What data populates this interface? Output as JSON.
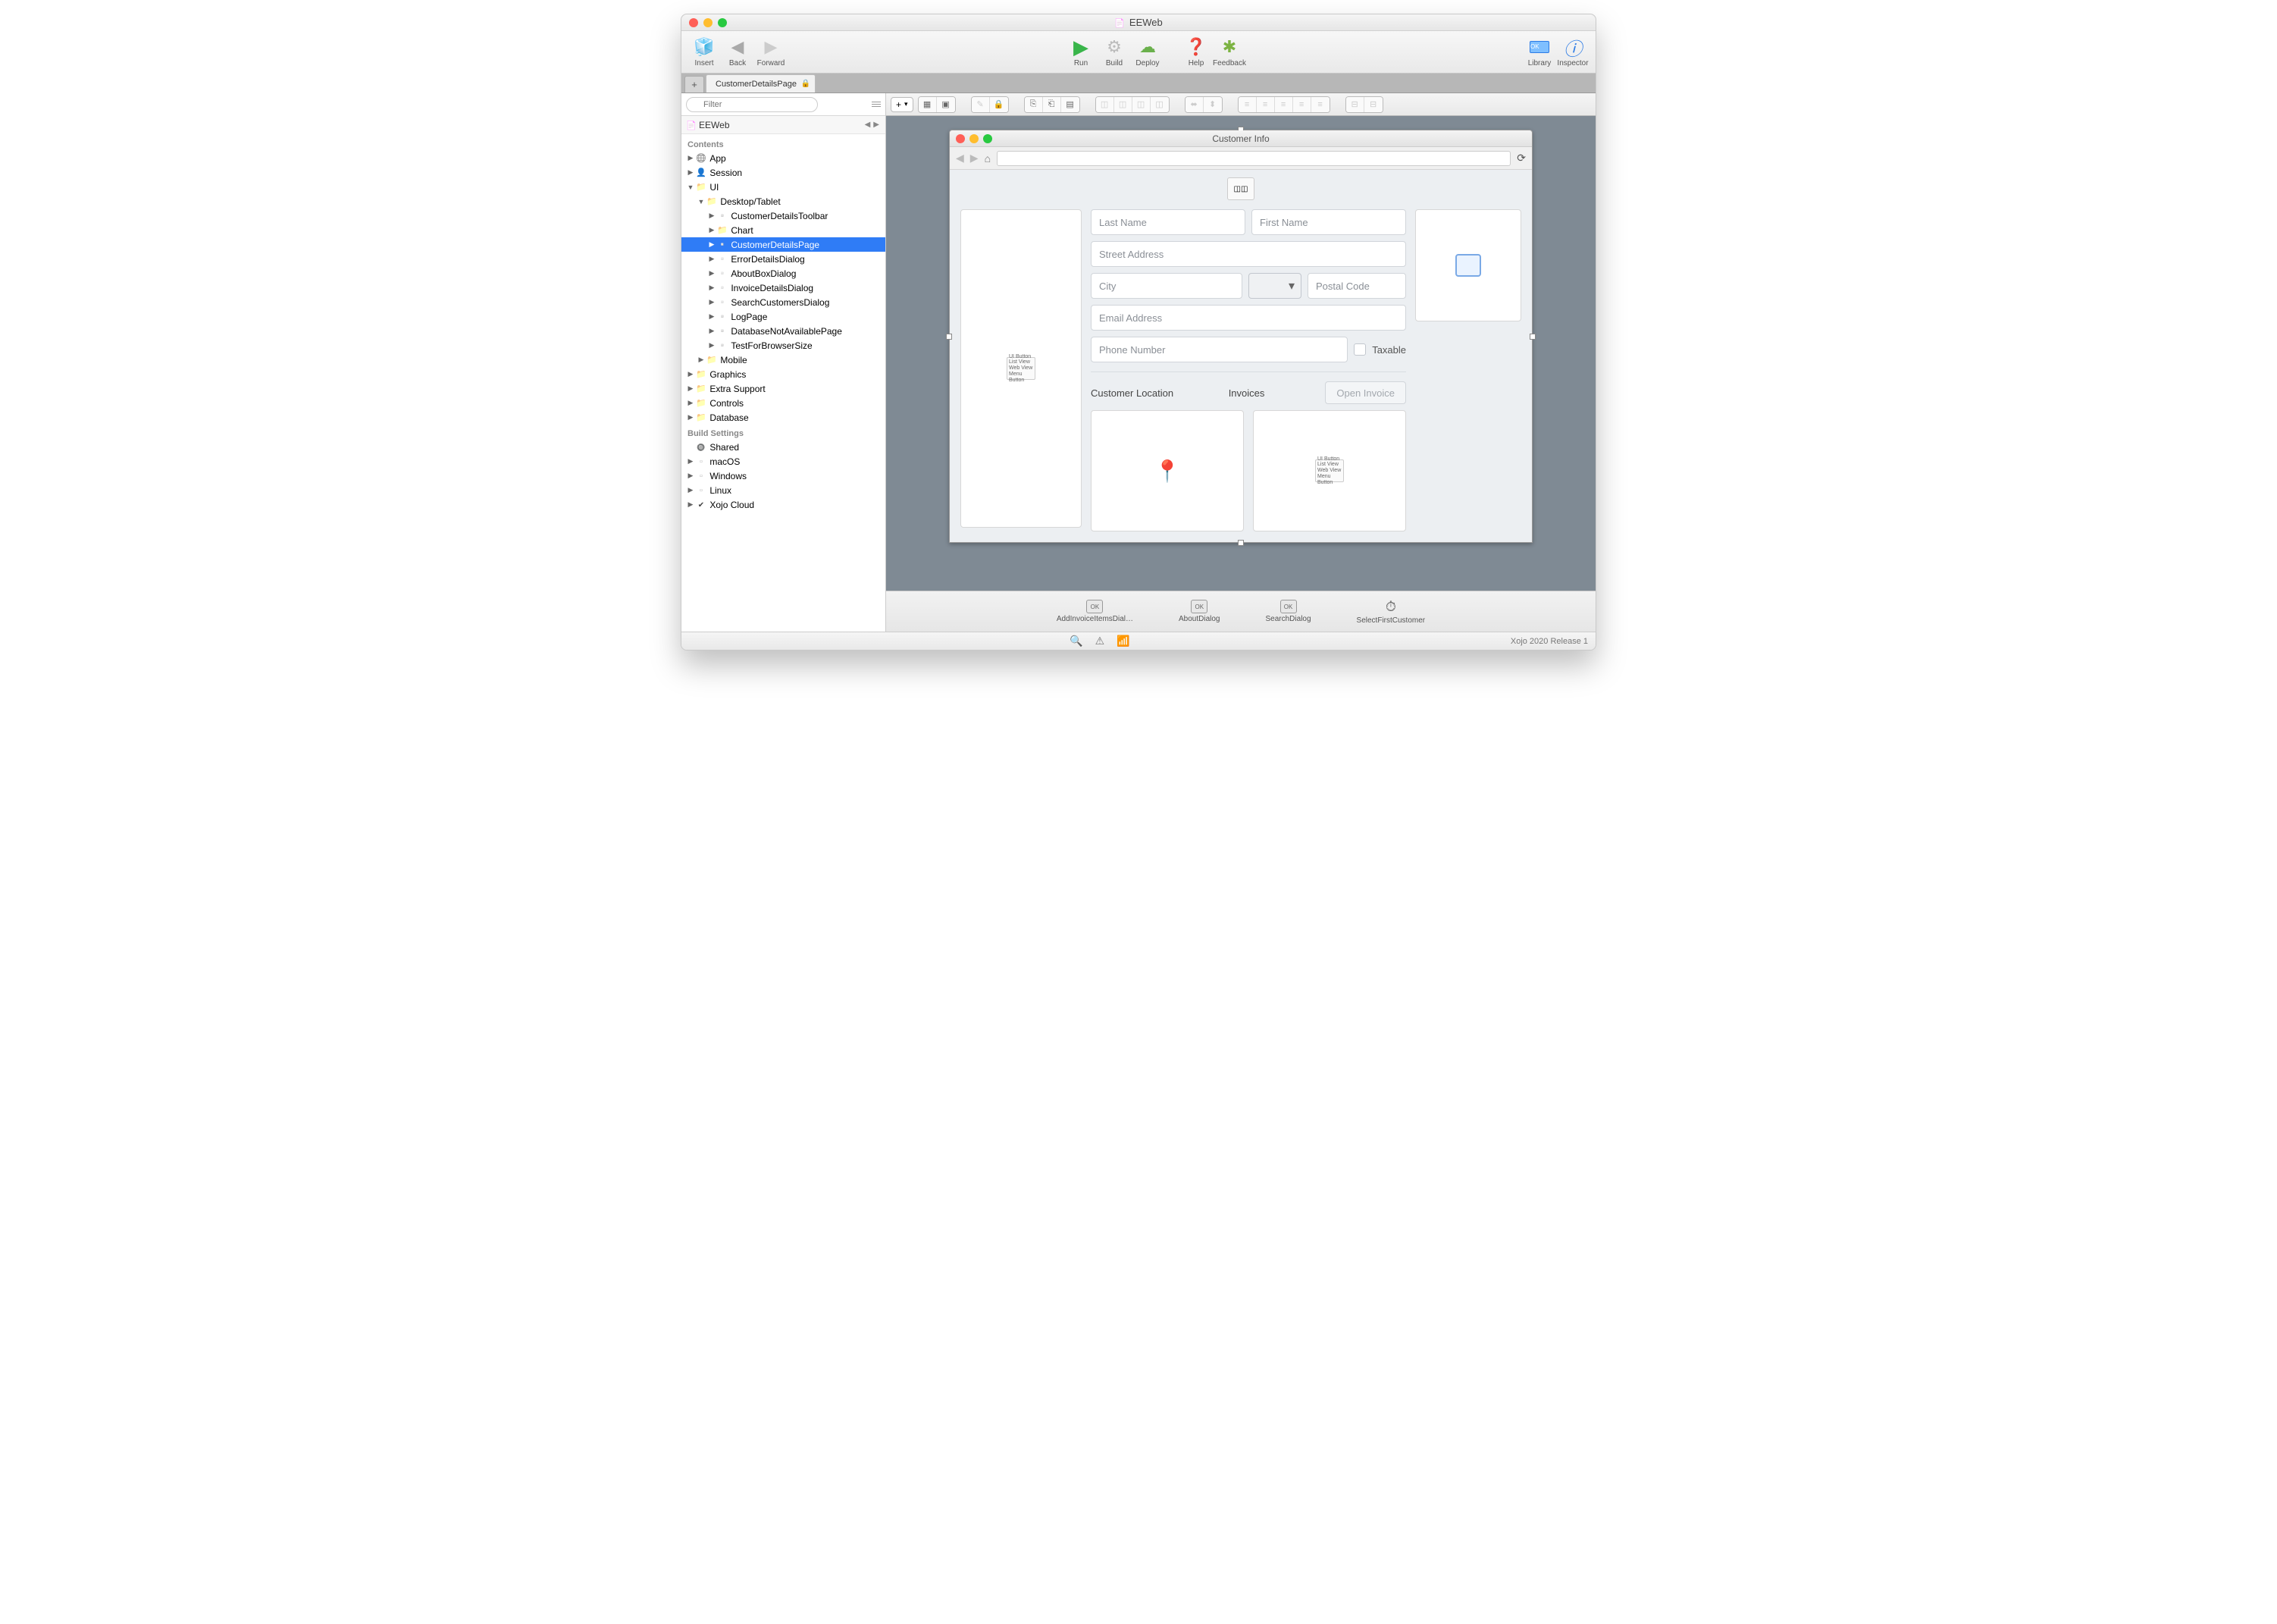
{
  "window_title": "EEWeb",
  "toolbar": {
    "insert": "Insert",
    "back": "Back",
    "forward": "Forward",
    "run": "Run",
    "build": "Build",
    "deploy": "Deploy",
    "help": "Help",
    "feedback": "Feedback",
    "library": "Library",
    "inspector": "Inspector"
  },
  "tab": {
    "name": "CustomerDetailsPage"
  },
  "filter_placeholder": "Filter",
  "project_name": "EEWeb",
  "sections": {
    "contents": "Contents",
    "build": "Build Settings"
  },
  "tree": {
    "app": "App",
    "session": "Session",
    "ui": "UI",
    "desktop": "Desktop/Tablet",
    "items": [
      "CustomerDetailsToolbar",
      "Chart",
      "CustomerDetailsPage",
      "ErrorDetailsDialog",
      "AboutBoxDialog",
      "InvoiceDetailsDialog",
      "SearchCustomersDialog",
      "LogPage",
      "DatabaseNotAvailablePage",
      "TestForBrowserSize"
    ],
    "mobile": "Mobile",
    "graphics": "Graphics",
    "extra": "Extra Support",
    "controls": "Controls",
    "database": "Database"
  },
  "build": {
    "shared": "Shared",
    "macos": "macOS",
    "windows": "Windows",
    "linux": "Linux",
    "cloud": "Xojo Cloud"
  },
  "mock": {
    "title": "Customer Info",
    "fields": {
      "last": "Last Name",
      "first": "First Name",
      "street": "Street Address",
      "city": "City",
      "postal": "Postal Code",
      "email": "Email Address",
      "phone": "Phone Number",
      "taxable": "Taxable"
    },
    "labels": {
      "location": "Customer Location",
      "invoices": "Invoices",
      "open": "Open Invoice"
    }
  },
  "tray": {
    "a": "AddInvoiceItemsDial…",
    "b": "AboutDialog",
    "c": "SearchDialog",
    "d": "SelectFirstCustomer"
  },
  "status": {
    "version": "Xojo 2020 Release 1"
  }
}
